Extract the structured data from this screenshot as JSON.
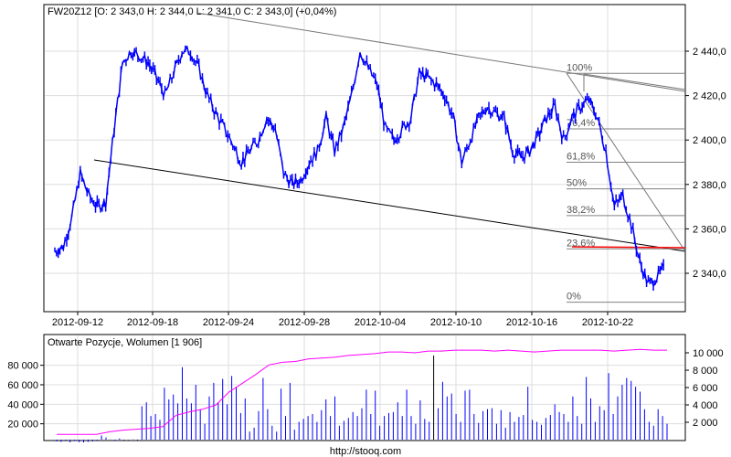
{
  "header": {
    "title": "FW20Z12 [O: 2 343,0  H: 2 344,0  L: 2 341,0  C: 2 343,0] (+0,04%)"
  },
  "footer": {
    "source": "http://stooq.com"
  },
  "colors": {
    "price": "#0000ff",
    "volume": "#0000ff",
    "open_interest": "#ff00ff",
    "fib": "#808080",
    "red": "#ff0000",
    "grid": "#dddddd"
  },
  "chart_data": [
    {
      "type": "line",
      "title": "FW20Z12 [O: 2 343,0  H: 2 344,0  L: 2 341,0  C: 2 343,0] (+0,04%)",
      "x_ticks": [
        "2012-09-12",
        "2012-09-18",
        "2012-09-24",
        "2012-09-28",
        "2012-10-04",
        "2012-10-10",
        "2012-10-16",
        "2012-10-22"
      ],
      "y_ticks": [
        "2 340,0",
        "2 360,0",
        "2 380,0",
        "2 400,0",
        "2 420,0",
        "2 440,0"
      ],
      "y_tick_values": [
        2340,
        2360,
        2380,
        2400,
        2420,
        2440
      ],
      "ylim": [
        2323,
        2461
      ],
      "values": [
        2350,
        2352,
        2365,
        2385,
        2375,
        2370,
        2372,
        2405,
        2435,
        2440,
        2438,
        2435,
        2428,
        2420,
        2430,
        2440,
        2440,
        2432,
        2420,
        2412,
        2405,
        2398,
        2390,
        2395,
        2400,
        2410,
        2405,
        2385,
        2380,
        2382,
        2390,
        2395,
        2410,
        2395,
        2405,
        2420,
        2440,
        2432,
        2425,
        2405,
        2400,
        2405,
        2410,
        2430,
        2428,
        2425,
        2420,
        2410,
        2390,
        2400,
        2410,
        2415,
        2412,
        2410,
        2395,
        2392,
        2395,
        2402,
        2410,
        2415,
        2400,
        2410,
        2415,
        2418,
        2410,
        2395,
        2370,
        2375,
        2362,
        2345,
        2335,
        2338,
        2343
      ],
      "fibonacci": [
        {
          "label": "100%",
          "value": 2430
        },
        {
          "label": "76,4%",
          "value": 2405
        },
        {
          "label": "61,8%",
          "value": 2390
        },
        {
          "label": "50%",
          "value": 2378
        },
        {
          "label": "38,2%",
          "value": 2366
        },
        {
          "label": "23,6%",
          "value": 2351
        },
        {
          "label": "0%",
          "value": 2327
        }
      ]
    },
    {
      "type": "bar",
      "title": "Otwarte Pozycje, Wolumen [1 906]",
      "left_ticks": [
        "20 000",
        "40 000",
        "60 000",
        "80 000"
      ],
      "left_tick_values": [
        20000,
        40000,
        60000,
        80000
      ],
      "right_ticks": [
        "2 000",
        "4 000",
        "6 000",
        "8 000",
        "10 000"
      ],
      "right_tick_values": [
        2000,
        4000,
        6000,
        8000,
        10000
      ],
      "volume": [
        2000,
        1500,
        3000,
        1000,
        2500,
        1200,
        800,
        1500,
        2000,
        3000,
        8000,
        6000,
        4000,
        2500,
        5000,
        3000,
        3500,
        4000,
        3000,
        38000,
        42000,
        28000,
        30000,
        24000,
        57000,
        45000,
        50000,
        41000,
        78000,
        46000,
        41000,
        60000,
        35000,
        20000,
        48000,
        62000,
        42000,
        66000,
        40000,
        69000,
        58000,
        31000,
        46000,
        12000,
        16000,
        33000,
        67000,
        35000,
        18000,
        12000,
        56000,
        28000,
        62000,
        14000,
        22000,
        25000,
        28000,
        30000,
        22000,
        34000,
        45000,
        28000,
        48000,
        18000,
        23000,
        26000,
        32000,
        28000,
        36000,
        55000,
        30000,
        54000,
        18000,
        28000,
        31000,
        32000,
        42000,
        28000,
        55000,
        28000,
        20000,
        44000,
        25000,
        22000,
        90000,
        36000,
        63000,
        48000,
        51000,
        30000,
        22000,
        54000,
        55000,
        30000,
        21000,
        33000,
        35000,
        36000,
        20000,
        34000,
        16000,
        32000,
        22000,
        27000,
        29000,
        58000,
        24000,
        22000,
        19000,
        26000,
        29000,
        40000,
        32000,
        30000,
        22000,
        48000,
        28000,
        20000,
        68000,
        46000,
        22000,
        38000,
        34000,
        72000,
        30000,
        48000,
        60000,
        67000,
        64000,
        58000,
        53000,
        35000,
        22000,
        18000,
        35000,
        28000,
        20000
      ],
      "open_interest": [
        600,
        600,
        600,
        600,
        900,
        1100,
        1200,
        1300,
        1500,
        2800,
        3200,
        3500,
        4000,
        5500,
        6500,
        7500,
        8600,
        8900,
        9000,
        9300,
        9400,
        9500,
        9700,
        9800,
        9900,
        10100,
        10100,
        10000,
        10200,
        10200,
        10300,
        10300,
        10300,
        10200,
        10300,
        10200,
        10100,
        10200,
        10300,
        10300,
        10300,
        10300,
        10200,
        10300,
        10400,
        10300,
        10300
      ]
    }
  ]
}
